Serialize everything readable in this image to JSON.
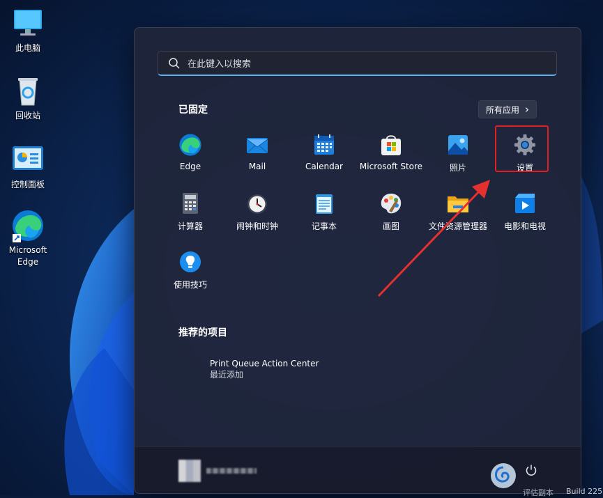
{
  "desktop": {
    "icons": [
      {
        "label": "此电脑",
        "icon": "computer-icon"
      },
      {
        "label": "回收站",
        "icon": "recycle-bin-icon"
      },
      {
        "label": "控制面板",
        "icon": "control-panel-icon"
      },
      {
        "label": "Microsoft Edge",
        "icon": "edge-icon"
      }
    ]
  },
  "start": {
    "search_placeholder": "在此键入以搜索",
    "pinned_title": "已固定",
    "all_apps_label": "所有应用",
    "all_apps_chevron": "›",
    "apps": [
      {
        "label": "Edge",
        "icon": "edge-icon"
      },
      {
        "label": "Mail",
        "icon": "mail-icon"
      },
      {
        "label": "Calendar",
        "icon": "calendar-icon"
      },
      {
        "label": "Microsoft Store",
        "icon": "store-icon"
      },
      {
        "label": "照片",
        "icon": "photos-icon"
      },
      {
        "label": "设置",
        "icon": "settings-gear-icon"
      },
      {
        "label": "计算器",
        "icon": "calculator-icon"
      },
      {
        "label": "闹钟和时钟",
        "icon": "clock-icon"
      },
      {
        "label": "记事本",
        "icon": "notepad-icon"
      },
      {
        "label": "画图",
        "icon": "paint-icon"
      },
      {
        "label": "文件资源管理器",
        "icon": "file-explorer-icon"
      },
      {
        "label": "电影和电视",
        "icon": "movies-tv-icon"
      },
      {
        "label": "使用技巧",
        "icon": "tips-icon"
      }
    ],
    "recommended_title": "推荐的项目",
    "recommended": [
      {
        "title": "Print Queue Action Center",
        "subtitle": "最近添加"
      }
    ]
  },
  "footer": {
    "power_icon": "power-icon"
  },
  "watermark": {
    "partial_text_1": "评估副本",
    "partial_text_2": "Build 225"
  },
  "colors": {
    "highlight_border": "#e02020",
    "arrow": "#e53030",
    "search_accent": "#5fb2f2"
  }
}
